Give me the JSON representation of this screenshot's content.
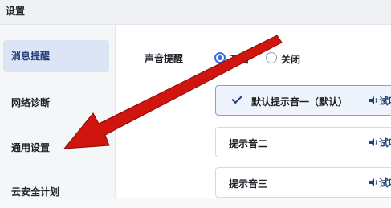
{
  "window": {
    "title": "设置"
  },
  "sidebar": {
    "items": [
      {
        "label": "消息提醒",
        "active": true
      },
      {
        "label": "网络诊断",
        "active": false
      },
      {
        "label": "通用设置",
        "active": false
      },
      {
        "label": "云安全计划",
        "active": false
      }
    ]
  },
  "sound_setting": {
    "label": "声音提醒",
    "options": [
      {
        "label": "开启",
        "selected": true
      },
      {
        "label": "关闭",
        "selected": false
      }
    ]
  },
  "sounds": [
    {
      "name": "默认提示音一（默认）",
      "selected": true,
      "preview_label": "试听"
    },
    {
      "name": "提示音二",
      "selected": false,
      "preview_label": "试听"
    },
    {
      "name": "提示音三",
      "selected": false,
      "preview_label": "试听"
    }
  ],
  "colors": {
    "accent": "#3a6fd8",
    "arrow": "#d0140e",
    "active_nav": "#dce5f6"
  },
  "icons": {
    "check": "check-icon",
    "speaker": "speaker-icon",
    "arrow": "red-arrow"
  }
}
